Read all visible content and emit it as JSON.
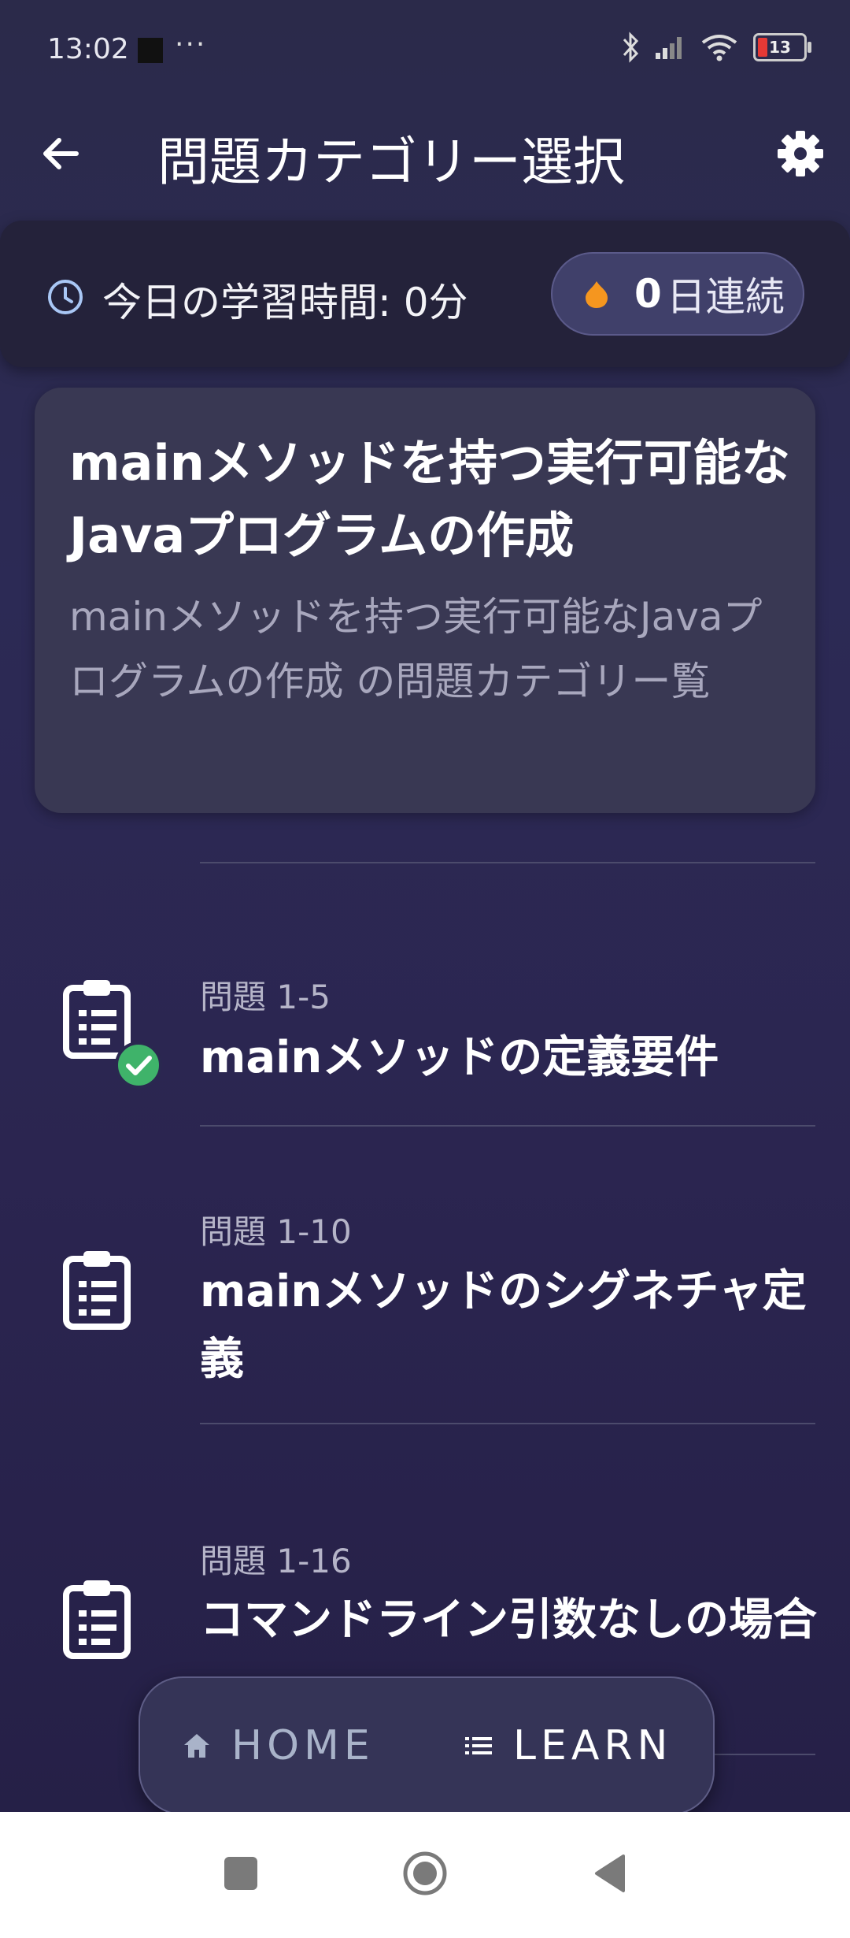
{
  "status_bar": {
    "time": "13:02",
    "dots": "···",
    "battery": "13"
  },
  "app_bar": {
    "title": "問題カテゴリー選択",
    "back_icon": "arrow-left-icon",
    "settings_icon": "gear-icon"
  },
  "stats": {
    "study_time": "今日の学習時間: 0分",
    "streak_count": "0",
    "streak_label": "日連続"
  },
  "category": {
    "title": "mainメソッドを持つ実行可能なJavaプログラムの作成",
    "description": "mainメソッドを持つ実行可能なJavaプログラムの作成 の問題カテゴリー覧"
  },
  "items": [
    {
      "number": "問題 1-5",
      "title": "mainメソッドの定義要件",
      "completed": true
    },
    {
      "number": "問題 1-10",
      "title": "mainメソッドのシグネチャ定義",
      "completed": false
    },
    {
      "number": "問題 1-16",
      "title": "コマンドライン引数なしの場合",
      "completed": false
    }
  ],
  "bottom_nav": {
    "home": "HOME",
    "learn": "LEARN"
  },
  "colors": {
    "check": "#3fb36a",
    "flame": "#f5961f",
    "accent_pill": "#40406a"
  }
}
